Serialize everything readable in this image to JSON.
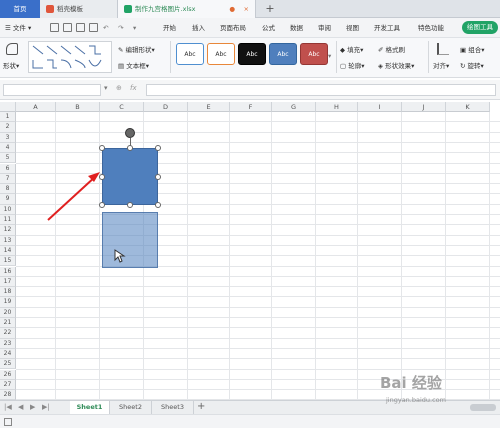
{
  "tabs": {
    "home": "首页",
    "template": "稻壳模板",
    "file": "制作九宫格图片.xlsx",
    "new_tab": "+"
  },
  "menu": {
    "file": "文件",
    "items": [
      "开始",
      "插入",
      "页面布局",
      "公式",
      "数据",
      "审阅",
      "视图",
      "开发工具",
      "特色功能"
    ],
    "active": "绘图工具"
  },
  "ribbon": {
    "shape": "形状",
    "edit_shape": "编辑形状",
    "text_box": "文本框",
    "style_label": "Abc",
    "fill": "填充",
    "outline": "轮廓",
    "format_painter": "格式刷",
    "shape_effects": "形状效果",
    "align": "对齐",
    "group": "组合",
    "rotate": "旋转"
  },
  "formula_bar": {
    "fx": "fx",
    "name_box": "",
    "value": ""
  },
  "columns": [
    "A",
    "B",
    "C",
    "D",
    "E",
    "F",
    "G",
    "H",
    "I",
    "J",
    "K"
  ],
  "rows": [
    "1",
    "2",
    "3",
    "4",
    "5",
    "6",
    "7",
    "8",
    "9",
    "10",
    "11",
    "12",
    "13",
    "14",
    "15",
    "16",
    "17",
    "18",
    "19",
    "20",
    "21",
    "22",
    "23",
    "24",
    "25",
    "26",
    "27",
    "28"
  ],
  "sheets": [
    "Sheet1",
    "Sheet2",
    "Sheet3"
  ],
  "active_sheet": "Sheet1",
  "watermark": {
    "brand": "Bai 经验",
    "url": "jingyan.baidu.com"
  },
  "colors": {
    "accent": "#21a366",
    "shape_fill": "#4f7fbd",
    "arrow": "#e02020"
  }
}
